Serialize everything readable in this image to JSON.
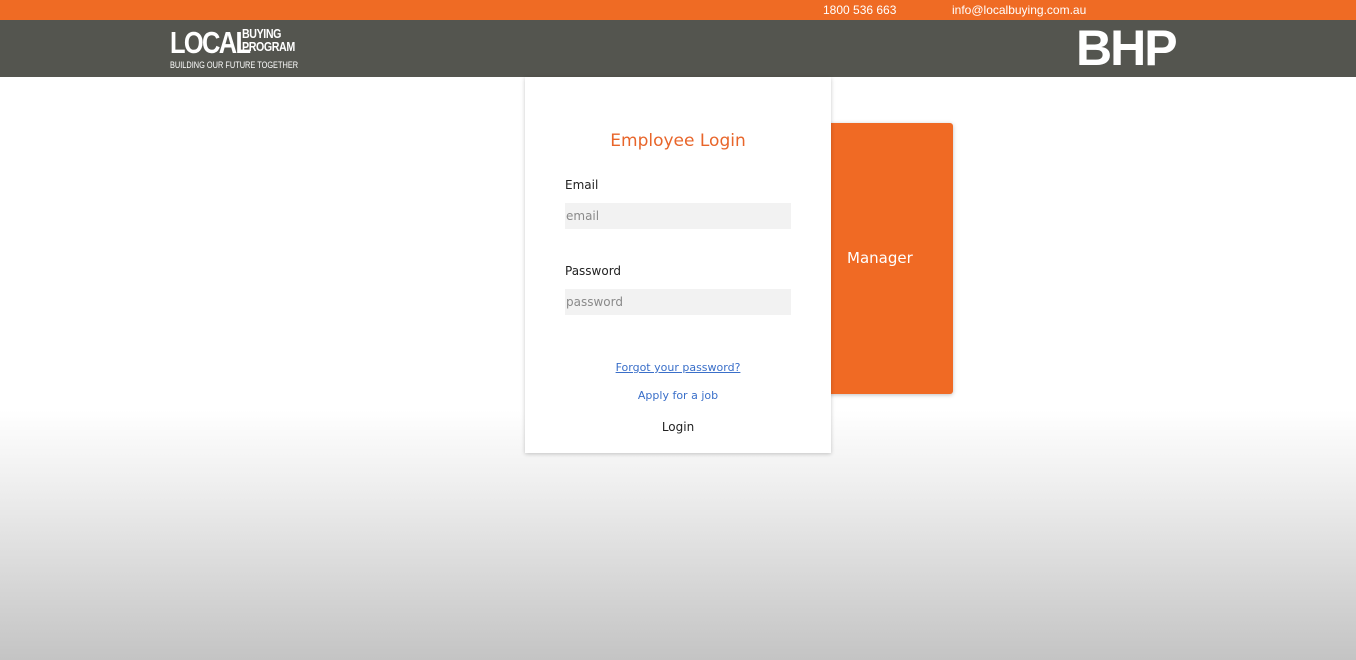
{
  "topbar": {
    "phone": "1800 536 663",
    "email": "info@localbuying.com.au"
  },
  "header": {
    "logo": {
      "word1": "LOCAL",
      "word2": "BUYING",
      "word3": "PROGRAM",
      "tagline": "BUILDING OUR FUTURE TOGETHER"
    },
    "partner_logo": "BHP"
  },
  "login": {
    "title": "Employee Login",
    "email_label": "Email",
    "email_placeholder": "email",
    "email_value": "",
    "password_label": "Password",
    "password_placeholder": "password",
    "password_value": "",
    "forgot_link": "Forgot your password?",
    "apply_link": "Apply for a job",
    "login_button": "Login"
  },
  "manager_panel": {
    "label": "Manager"
  },
  "colors": {
    "accent": "#ef6b24",
    "header_bg": "#54554f",
    "title": "#e8652a",
    "link": "#3a6fc9"
  }
}
